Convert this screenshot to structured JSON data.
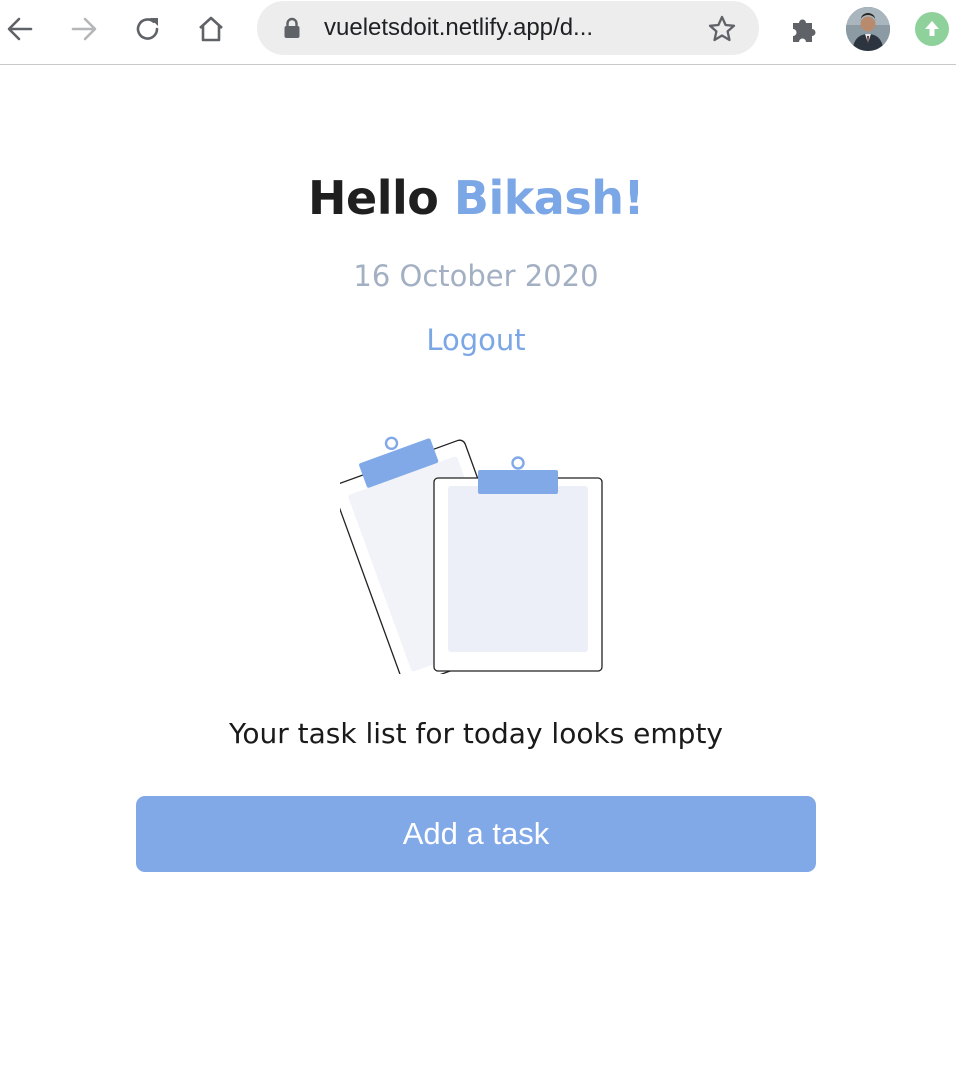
{
  "browser": {
    "url": "vueletsdoit.netlify.app/d...",
    "icons": {
      "back": "arrow-left-icon",
      "forward": "arrow-right-icon",
      "reload": "reload-icon",
      "home": "home-icon",
      "lock": "lock-icon",
      "bookmark": "star-icon",
      "extensions": "puzzle-icon",
      "update": "arrow-up-icon"
    }
  },
  "greeting": {
    "prefix": "Hello",
    "name": "Bikash!"
  },
  "date": "16 October 2020",
  "logout_label": "Logout",
  "empty_state": {
    "illustration": "clipboards-illustration",
    "message": "Your task list for today looks empty"
  },
  "add_task_label": "Add a task",
  "colors": {
    "accent": "#7ba7e6",
    "button": "#81a9e8",
    "muted": "#a3b0c4",
    "text": "#1f1f1f"
  }
}
